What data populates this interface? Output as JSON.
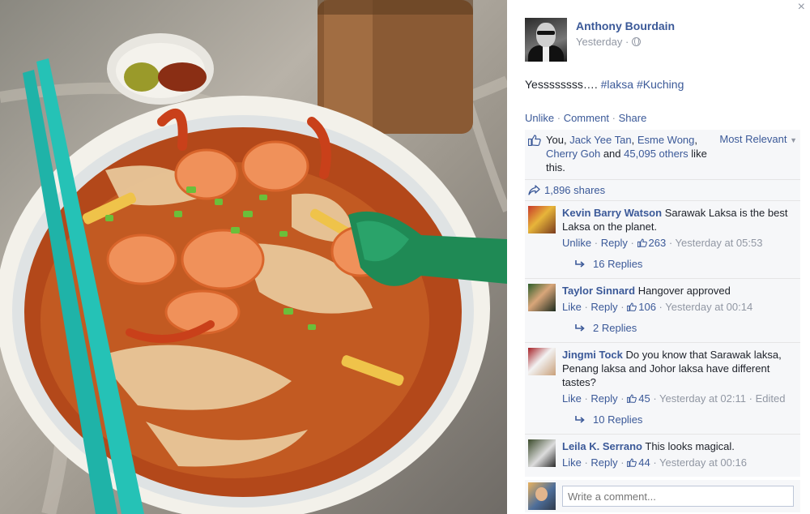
{
  "post": {
    "author": "Anthony Bourdain",
    "time": "Yesterday ·",
    "text": "Yessssssss….",
    "hashtags": [
      "#laksa",
      "#Kuching"
    ]
  },
  "actions": {
    "unlike": "Unlike",
    "comment": "Comment",
    "share": "Share",
    "sep": " · "
  },
  "likes": {
    "you": "You,",
    "names": [
      "Jack Yee Tan",
      "Esme Wong",
      "Cherry Goh"
    ],
    "and": "and",
    "others": "45,095 others",
    "like_this": "like this."
  },
  "sort": {
    "label": "Most Relevant",
    "caret": "▼"
  },
  "shares": "1,896 shares",
  "comments": [
    {
      "author": "Kevin Barry Watson",
      "text": "Sarawak Laksa is the best Laksa on the planet.",
      "action": "Unlike",
      "reply": "Reply",
      "likes": "263",
      "time": "Yesterday at 05:53",
      "edited": "",
      "replies": "16 Replies"
    },
    {
      "author": "Taylor Sinnard",
      "text": "Hangover approved",
      "action": "Like",
      "reply": "Reply",
      "likes": "106",
      "time": "Yesterday at 00:14",
      "edited": "",
      "replies": "2 Replies"
    },
    {
      "author": "Jingmi Tock",
      "text": "Do you know that Sarawak laksa, Penang laksa and Johor laksa have different tastes?",
      "action": "Like",
      "reply": "Reply",
      "likes": "45",
      "time": "Yesterday at 02:11",
      "edited": "Edited",
      "replies": "10 Replies"
    },
    {
      "author": "Leila K. Serrano",
      "text": "This looks magical.",
      "action": "Like",
      "reply": "Reply",
      "likes": "44",
      "time": "Yesterday at 00:16",
      "edited": "",
      "replies": ""
    }
  ],
  "compose": {
    "placeholder": "Write a comment..."
  },
  "close": "×",
  "colors": {
    "link": "#3b5998",
    "meta": "#9197a3",
    "ufi_bg": "#f6f7f9"
  }
}
